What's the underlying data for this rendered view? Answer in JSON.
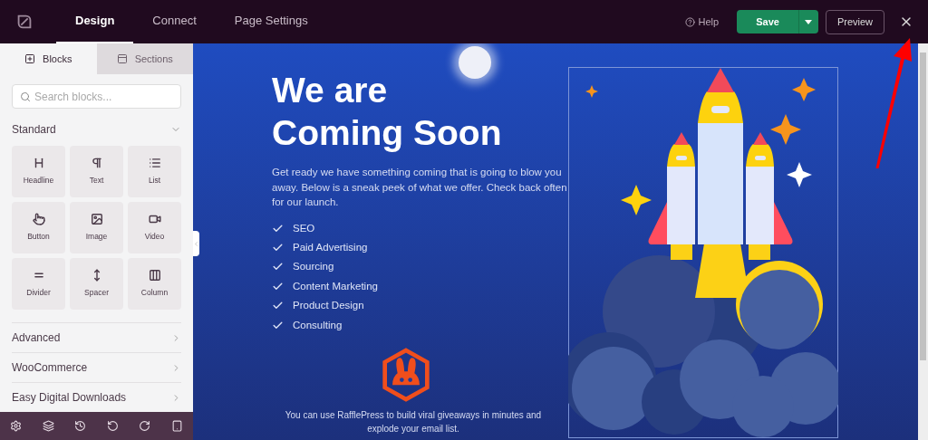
{
  "topbar": {
    "tabs": [
      {
        "label": "Design",
        "selected": true
      },
      {
        "label": "Connect",
        "selected": false
      },
      {
        "label": "Page Settings",
        "selected": false
      }
    ],
    "help": "Help",
    "save": "Save",
    "preview": "Preview"
  },
  "sidebar": {
    "tabs": [
      {
        "label": "Blocks",
        "kind": "blocks",
        "selected": true
      },
      {
        "label": "Sections",
        "kind": "sections",
        "selected": false
      }
    ],
    "search": {
      "placeholder": "Search blocks..."
    },
    "section": {
      "title": "Standard",
      "expanded": true
    },
    "blocks": [
      {
        "label": "Headline",
        "kind": "headline"
      },
      {
        "label": "Text",
        "kind": "text"
      },
      {
        "label": "List",
        "kind": "list"
      },
      {
        "label": "Button",
        "kind": "button"
      },
      {
        "label": "Image",
        "kind": "image"
      },
      {
        "label": "Video",
        "kind": "video"
      },
      {
        "label": "Divider",
        "kind": "divider"
      },
      {
        "label": "Spacer",
        "kind": "spacer"
      },
      {
        "label": "Column",
        "kind": "column"
      }
    ],
    "categories": [
      {
        "title": "Advanced",
        "expanded": false
      },
      {
        "title": "WooCommerce",
        "expanded": false
      },
      {
        "title": "Easy Digital Downloads",
        "expanded": false
      }
    ],
    "toolbar": [
      {
        "kind": "settings"
      },
      {
        "kind": "layers"
      },
      {
        "kind": "history"
      },
      {
        "kind": "undo"
      },
      {
        "kind": "redo"
      },
      {
        "kind": "mobile"
      }
    ]
  },
  "canvas": {
    "heading": "We are Coming Soon",
    "paragraph": "Get ready we have something coming that is going to blow you away. Below is a sneak peek of what we offer. Check back often for our launch.",
    "features": [
      "SEO",
      "Paid Advertising",
      "Sourcing",
      "Content Marketing",
      "Product Design",
      "Consulting"
    ],
    "footer": "You can use RafflePress to build viral giveaways in minutes and explode your email list."
  }
}
